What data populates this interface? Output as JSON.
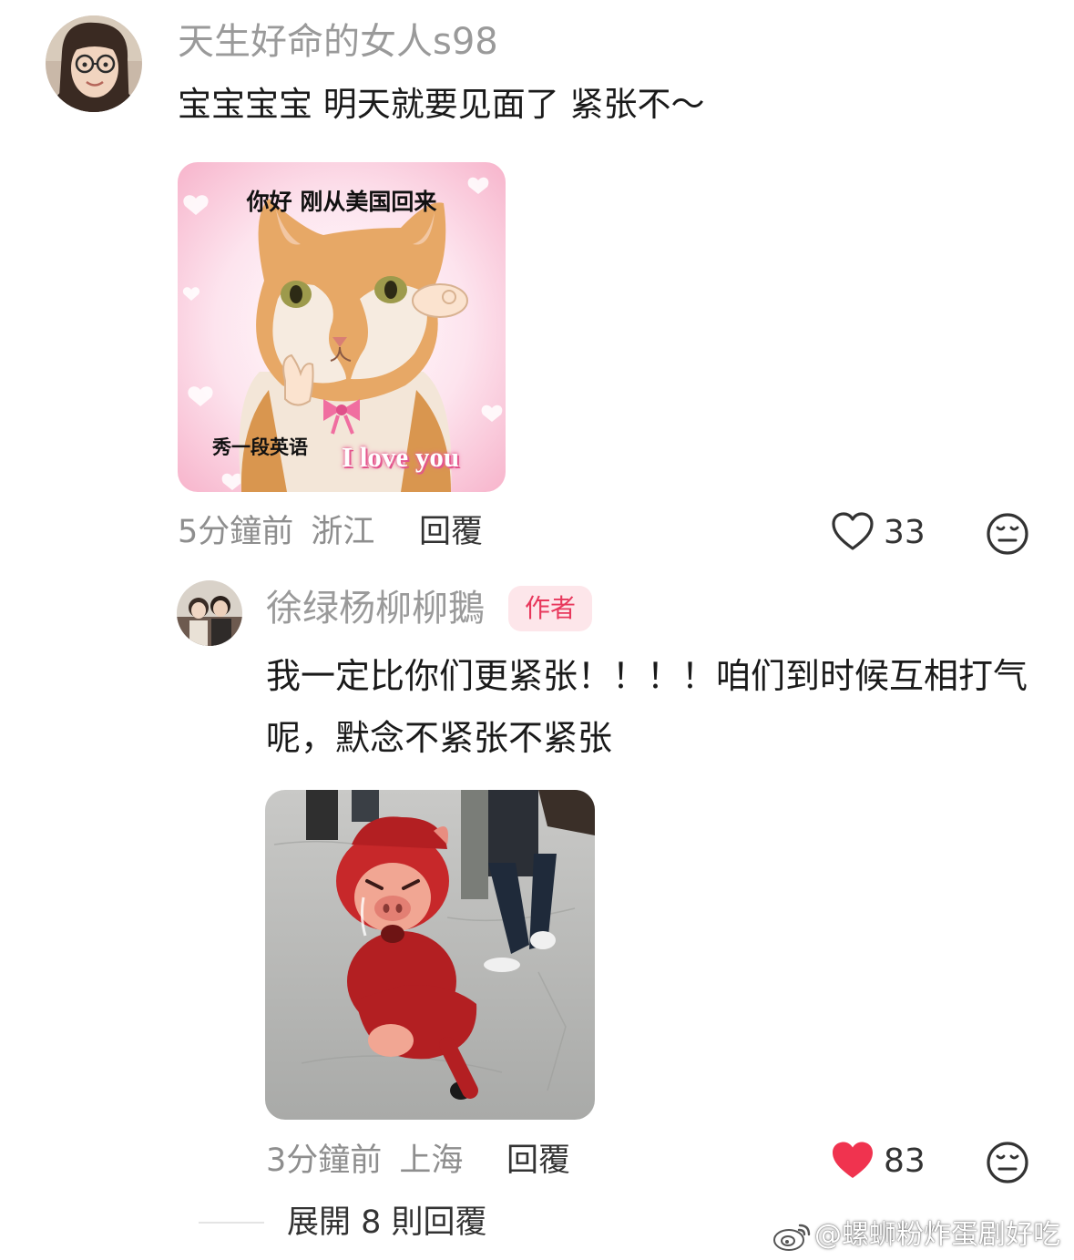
{
  "comments": [
    {
      "username": "天生好命的女人s98",
      "text": "宝宝宝宝 明天就要见面了 紧张不～",
      "sticker": {
        "top_caption": "你好 刚从美国回来",
        "bottom_caption": "秀一段英语",
        "highlight_caption": "I love you"
      },
      "time": "5分鐘前",
      "location": "浙江",
      "reply_label": "回覆",
      "likes": "33",
      "liked": false
    },
    {
      "username": "徐绿杨柳柳鵝",
      "badge": "作者",
      "text": "我一定比你们更紧张！！！！咱们到时候互相打气呢，默念不紧张不紧张",
      "time": "3分鐘前",
      "location": "上海",
      "reply_label": "回覆",
      "likes": "83",
      "liked": true
    }
  ],
  "expand_replies": "展開 8 則回覆",
  "watermark": "@螺蛳粉炸蛋剧好吃",
  "colors": {
    "username": "#9a9a9a",
    "liked_heart": "#f0334f",
    "badge_bg": "#fde6ea",
    "badge_text": "#e8385c"
  },
  "icons": {
    "like": "heart-outline-icon",
    "liked": "heart-filled-icon",
    "dislike": "meh-face-icon",
    "weibo": "weibo-icon"
  }
}
